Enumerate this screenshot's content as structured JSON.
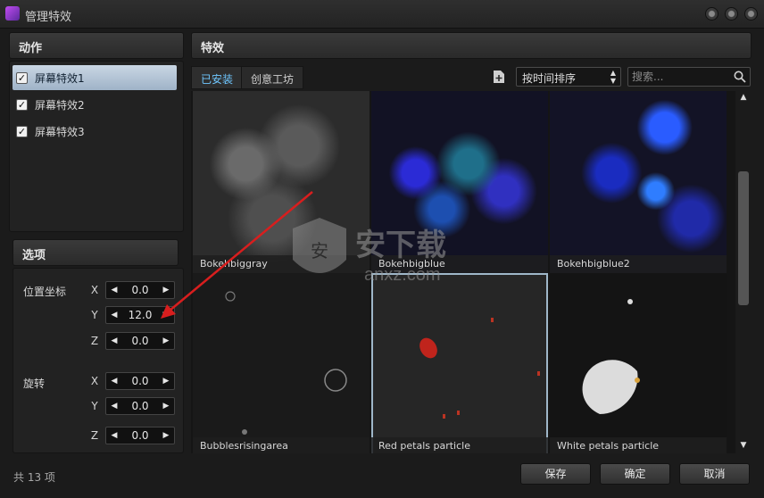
{
  "window": {
    "title": "管理特效"
  },
  "actions_panel": {
    "header": "动作",
    "items": [
      {
        "label": "屏幕特效1",
        "checked": true
      },
      {
        "label": "屏幕特效2",
        "checked": true
      },
      {
        "label": "屏幕特效3",
        "checked": true
      }
    ]
  },
  "options_panel": {
    "header": "选项",
    "position_label": "位置坐标",
    "rotation_label": "旋转",
    "axes": [
      "X",
      "Y",
      "Z"
    ],
    "position": {
      "x": "0.0",
      "y": "12.0",
      "z": "0.0"
    },
    "rotation": {
      "x": "0.0",
      "y": "0.0",
      "z": "0.0"
    }
  },
  "effects_panel": {
    "header": "特效",
    "tabs": [
      "已安装",
      "创意工坊"
    ],
    "active_tab": "已安装",
    "sort_value": "按时间排序",
    "search_placeholder": "搜索...",
    "items": [
      {
        "caption": "Bokehbiggray"
      },
      {
        "caption": "Bokehbigblue"
      },
      {
        "caption": "Bokehbigblue2"
      },
      {
        "caption": "Bubblesrisingarea"
      },
      {
        "caption": "Red petals particle",
        "selected": true
      },
      {
        "caption": "White petals particle"
      }
    ]
  },
  "footer": {
    "count_text": "共 13 项",
    "save_label": "保存",
    "ok_label": "确定",
    "cancel_label": "取消"
  },
  "watermark": {
    "text": "安下载",
    "subtext": "anxz.com"
  },
  "icons": {
    "check": "checkmark-icon",
    "left": "triangle-left-icon",
    "right": "triangle-right-icon",
    "search": "search-icon",
    "add": "add-file-icon"
  },
  "colors": {
    "accent_tab": "#6fc7ff",
    "selection": "#9fb7c9",
    "arrow": "#d81e1e"
  }
}
